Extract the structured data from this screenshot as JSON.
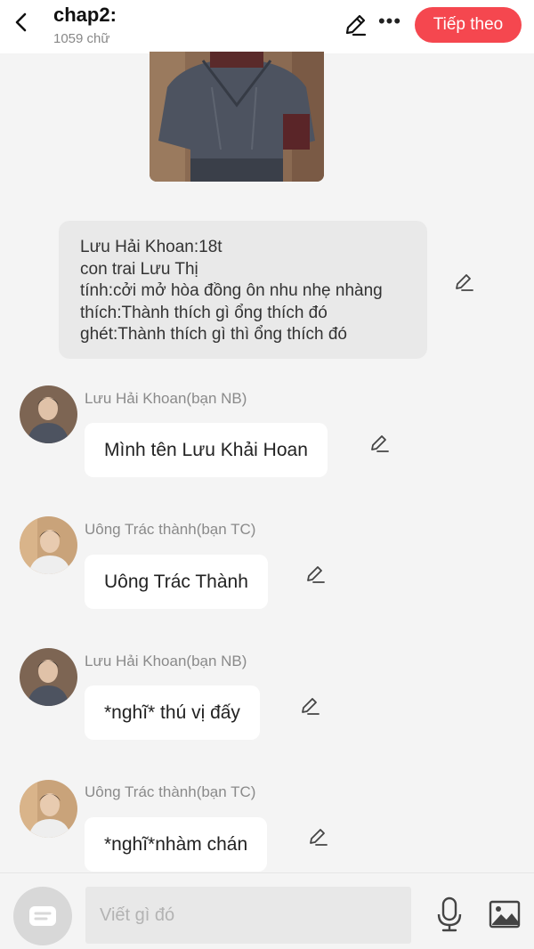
{
  "header": {
    "title": "chap2:",
    "word_count": "1059 chữ",
    "next_label": "Tiếp theo",
    "icons": [
      "chevron-left-icon",
      "pencil-icon",
      "more-icon"
    ]
  },
  "colors": {
    "accent": "#f5474f",
    "background": "#f4f4f4",
    "bubble": "#ffffff",
    "info_card": "#e9e9e9",
    "muted_text": "#8a8a8a"
  },
  "info_card": {
    "lines": [
      "Lưu Hải Khoan:18t",
      "con trai Lưu Thị",
      "tính:cởi mở hòa đồng ôn nhu nhẹ nhàng",
      "thích:Thành thích gì ổng thích đó",
      "ghét:Thành thích gì thì ổng thích đó"
    ]
  },
  "messages": [
    {
      "sender": "Lưu Hải Khoan(bạn NB)",
      "text": "Mình tên Lưu Khải Hoan"
    },
    {
      "sender": "Uông Trác thành(bạn TC)",
      "text": "Uông Trác Thành"
    },
    {
      "sender": "Lưu Hải Khoan(bạn NB)",
      "text": "*nghĩ* thú vị đấy"
    },
    {
      "sender": "Uông Trác thành(bạn TC)",
      "text": "*nghĩ*nhàm chán"
    }
  ],
  "composer": {
    "placeholder": "Viết gì đó",
    "icons": [
      "chat-icon",
      "microphone-icon",
      "image-icon"
    ]
  }
}
